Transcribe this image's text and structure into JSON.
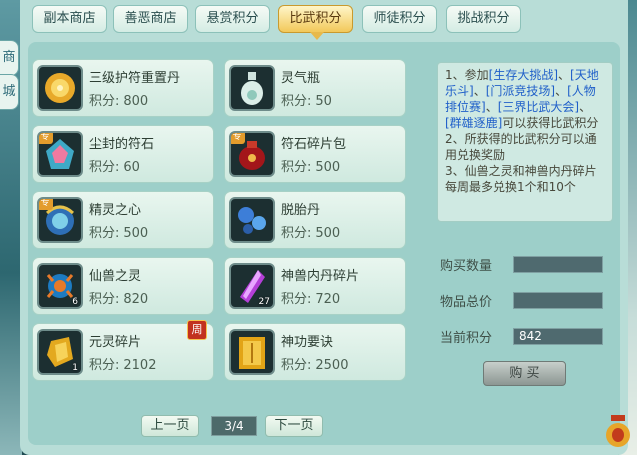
{
  "left_edge": {
    "tab1": "商",
    "tab2": "城"
  },
  "tabs": [
    {
      "label": "副本商店",
      "active": false
    },
    {
      "label": "善恶商店",
      "active": false
    },
    {
      "label": "悬赏积分",
      "active": false
    },
    {
      "label": "比武积分",
      "active": true
    },
    {
      "label": "师徒积分",
      "active": false
    },
    {
      "label": "挑战积分",
      "active": false
    }
  ],
  "price_label": "积分:",
  "items": [
    {
      "name": "三级护符重置丹",
      "price": "800",
      "icon": "gold-orb-icon"
    },
    {
      "name": "灵气瓶",
      "price": "50",
      "icon": "vase-icon"
    },
    {
      "name": "尘封的符石",
      "price": "60",
      "icon": "rune-stone-icon",
      "tag": "专"
    },
    {
      "name": "符石碎片包",
      "price": "500",
      "icon": "red-pouch-icon",
      "tag": "专"
    },
    {
      "name": "精灵之心",
      "price": "500",
      "icon": "spirit-heart-icon",
      "tag": "专"
    },
    {
      "name": "脱胎丹",
      "price": "500",
      "icon": "blue-pills-icon"
    },
    {
      "name": "仙兽之灵",
      "price": "820",
      "icon": "beast-spirit-icon",
      "qty": "6"
    },
    {
      "name": "神兽内丹碎片",
      "price": "720",
      "icon": "purple-crystal-icon",
      "qty": "27"
    },
    {
      "name": "元灵碎片",
      "price": "2102",
      "icon": "gold-fragment-icon",
      "qty": "1",
      "week": "周"
    },
    {
      "name": "神功要诀",
      "price": "2500",
      "icon": "golden-book-icon"
    }
  ],
  "rules": {
    "l1a": "1、参加",
    "link1": "[生存大挑战]",
    "sep1": "、",
    "link2": "[天地乐斗]",
    "sep2": "、",
    "link3": "[门派竞技场]",
    "sep3": "、",
    "link4": "[人物排位赛]",
    "sep4": "、",
    "link5": "[三界比武大会]",
    "sep5": "、",
    "link6": "[群雄逐鹿]",
    "l1b": "可以获得比武积分",
    "l2": "2、所获得的比武积分可以通用兑换奖励",
    "l3": "3、仙兽之灵和神兽内丹碎片每周最多兑换1个和10个"
  },
  "form": {
    "qty_label": "购买数量",
    "qty_value": "",
    "total_label": "物品总价",
    "total_value": "",
    "points_label": "当前积分",
    "points_value": "842",
    "buy_label": "购 买"
  },
  "pager": {
    "prev": "上一页",
    "page": "3/4",
    "next": "下一页"
  },
  "colors": {
    "active_tab": "#f2c85a",
    "link": "#1f5fc9",
    "panel": "#b8ddd7"
  }
}
